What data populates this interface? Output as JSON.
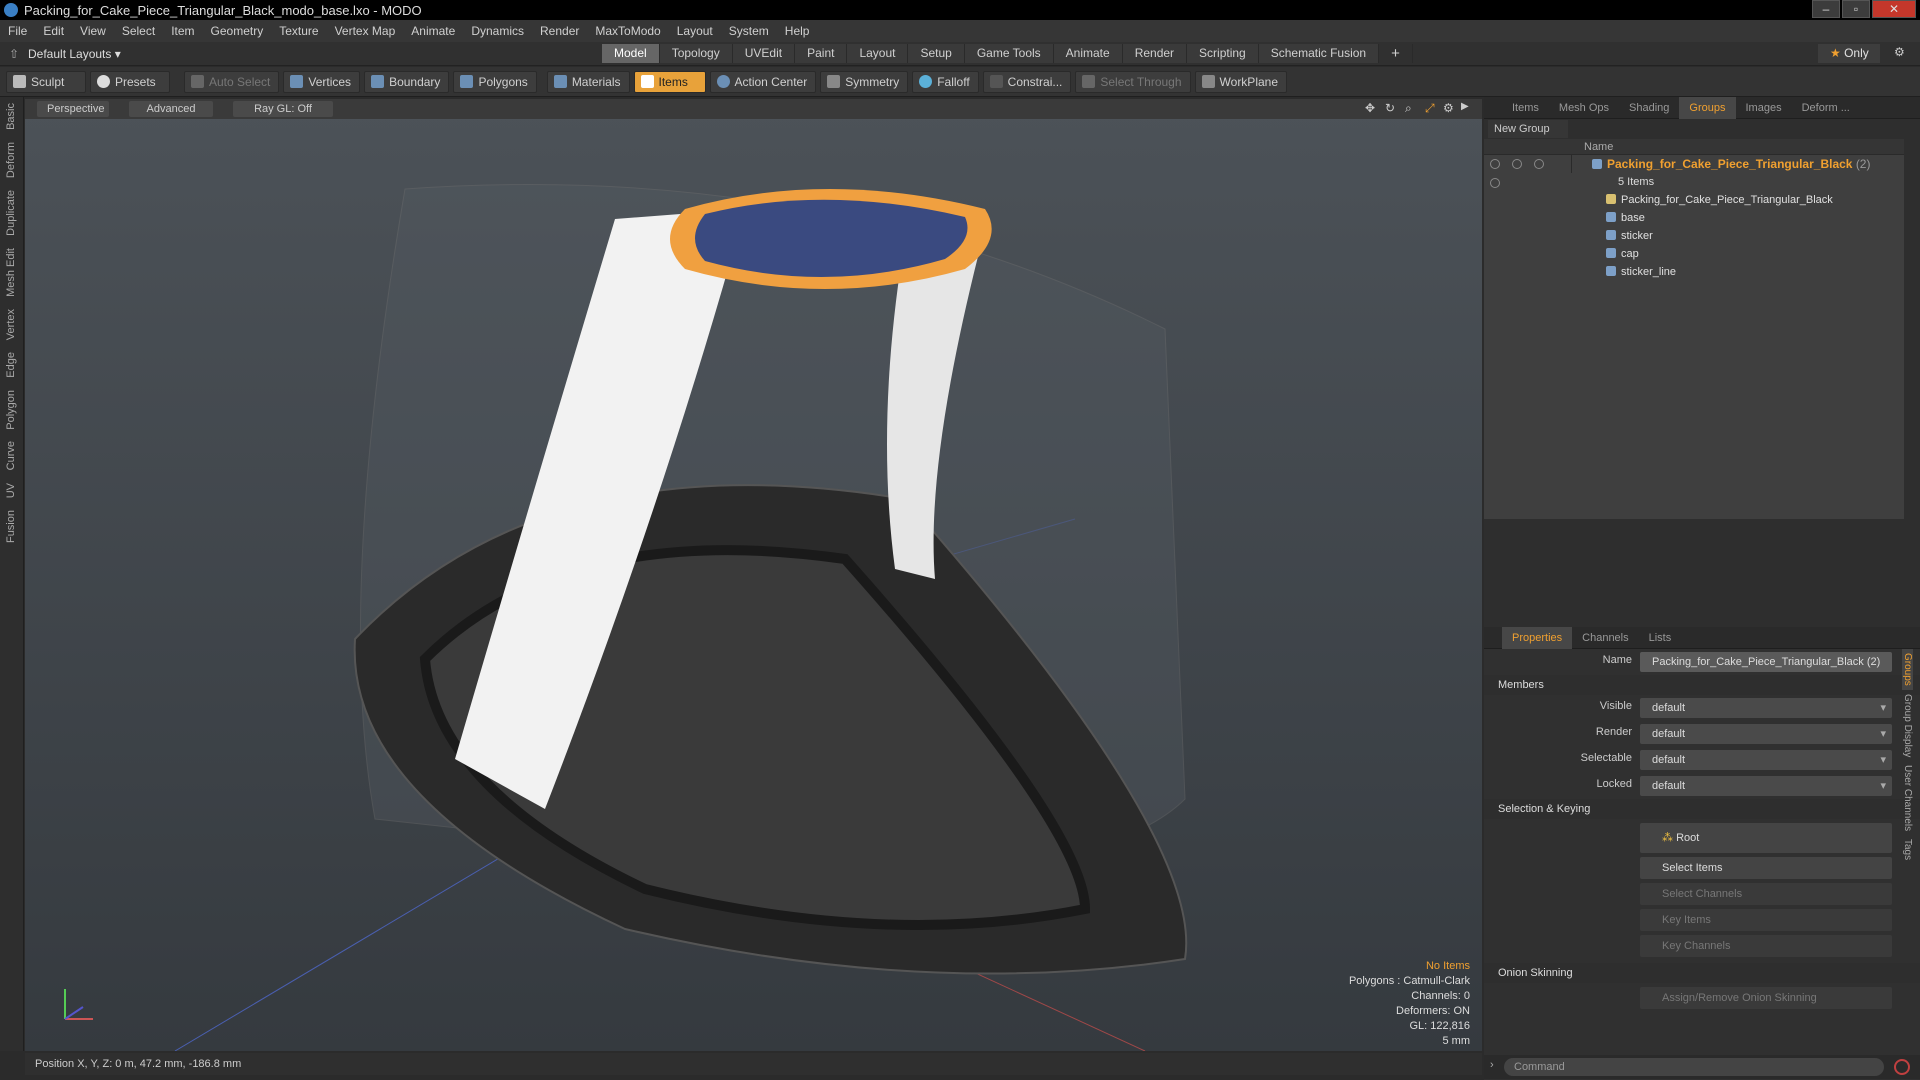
{
  "window": {
    "title": "Packing_for_Cake_Piece_Triangular_Black_modo_base.lxo - MODO"
  },
  "menu": [
    "File",
    "Edit",
    "View",
    "Select",
    "Item",
    "Geometry",
    "Texture",
    "Vertex Map",
    "Animate",
    "Dynamics",
    "Render",
    "MaxToModo",
    "Layout",
    "System",
    "Help"
  ],
  "layouts": {
    "default": "Default Layouts",
    "tabs": [
      "Model",
      "Topology",
      "UVEdit",
      "Paint",
      "Layout",
      "Setup",
      "Game Tools",
      "Animate",
      "Render",
      "Scripting",
      "Schematic Fusion"
    ],
    "plus": "+",
    "only": "Only"
  },
  "toolbar": {
    "sculpt": "Sculpt",
    "presets": "Presets",
    "auto_select": "Auto Select",
    "vertices": "Vertices",
    "boundary": "Boundary",
    "polygons": "Polygons",
    "materials": "Materials",
    "items": "Items",
    "action_center": "Action Center",
    "symmetry": "Symmetry",
    "falloff": "Falloff",
    "constraints": "Constrai...",
    "select_through": "Select Through",
    "workplane": "WorkPlane"
  },
  "left_tabs": [
    "Basic",
    "Deform",
    "Duplicate",
    "Mesh Edit",
    "Vertex",
    "Edge",
    "Polygon",
    "Curve",
    "UV",
    "Fusion"
  ],
  "viewport": {
    "perspective": "Perspective",
    "advanced": "Advanced",
    "raygl": "Ray GL: Off",
    "info": {
      "no_items": "No Items",
      "polygons": "Polygons : Catmull-Clark",
      "channels": "Channels: 0",
      "deformers": "Deformers: ON",
      "gl": "GL: 122,816",
      "scale": "5 mm"
    }
  },
  "status": {
    "position": "Position X, Y, Z:  0 m, 47.2 mm, -186.8 mm"
  },
  "groups_panel": {
    "tabs": [
      "Items",
      "Mesh Ops",
      "Shading",
      "Groups",
      "Images",
      "Deform ..."
    ],
    "new_group": "New Group",
    "name_header": "Name",
    "root": {
      "name": "Packing_for_Cake_Piece_Triangular_Black",
      "count": "(2)",
      "sub": "5 Items"
    },
    "items": [
      "Packing_for_Cake_Piece_Triangular_Black",
      "base",
      "sticker",
      "cap",
      "sticker_line"
    ]
  },
  "properties": {
    "tabs": [
      "Properties",
      "Channels",
      "Lists"
    ],
    "name_label": "Name",
    "name_value": "Packing_for_Cake_Piece_Triangular_Black (2)",
    "members": "Members",
    "visible": "Visible",
    "render": "Render",
    "selectable": "Selectable",
    "locked": "Locked",
    "default": "default",
    "selection_keying": "Selection & Keying",
    "root": "Root",
    "select_items": "Select Items",
    "select_channels": "Select Channels",
    "key_items": "Key Items",
    "key_channels": "Key Channels",
    "onion": "Onion Skinning",
    "assign_onion": "Assign/Remove Onion Skinning",
    "side_tabs": [
      "Groups",
      "Group Display",
      "User Channels",
      "Tags"
    ]
  },
  "command": {
    "placeholder": "Command"
  }
}
